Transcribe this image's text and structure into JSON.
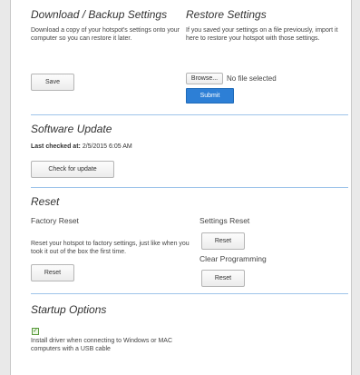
{
  "download": {
    "title": "Download / Backup Settings",
    "description": "Download a copy of your hotspot's settings onto your computer so you can restore it later.",
    "save_label": "Save"
  },
  "restore": {
    "title": "Restore Settings",
    "description": "If you saved your settings on a file previously, import it here to restore your hotspot with those settings.",
    "browse_label": "Browse...",
    "file_status": "No file selected",
    "submit_label": "Submit"
  },
  "software_update": {
    "title": "Software Update",
    "last_checked_label": "Last checked at:",
    "last_checked_value": "2/5/2015 6:05 AM",
    "check_label": "Check for update"
  },
  "reset": {
    "title": "Reset",
    "factory_title": "Factory Reset",
    "factory_description": "Reset your hotspot to factory settings, just like when you took it out of the box the first time.",
    "factory_button": "Reset",
    "settings_title": "Settings Reset",
    "settings_button": "Reset",
    "clear_title": "Clear Programming",
    "clear_button": "Reset"
  },
  "startup": {
    "title": "Startup Options",
    "checked": true,
    "driver_label": "Install driver when connecting to Windows or MAC computers with a USB cable"
  },
  "colors": {
    "accent": "#2d7fd6",
    "divider": "#9ec4ea",
    "checkbox": "#5a9a3c"
  }
}
